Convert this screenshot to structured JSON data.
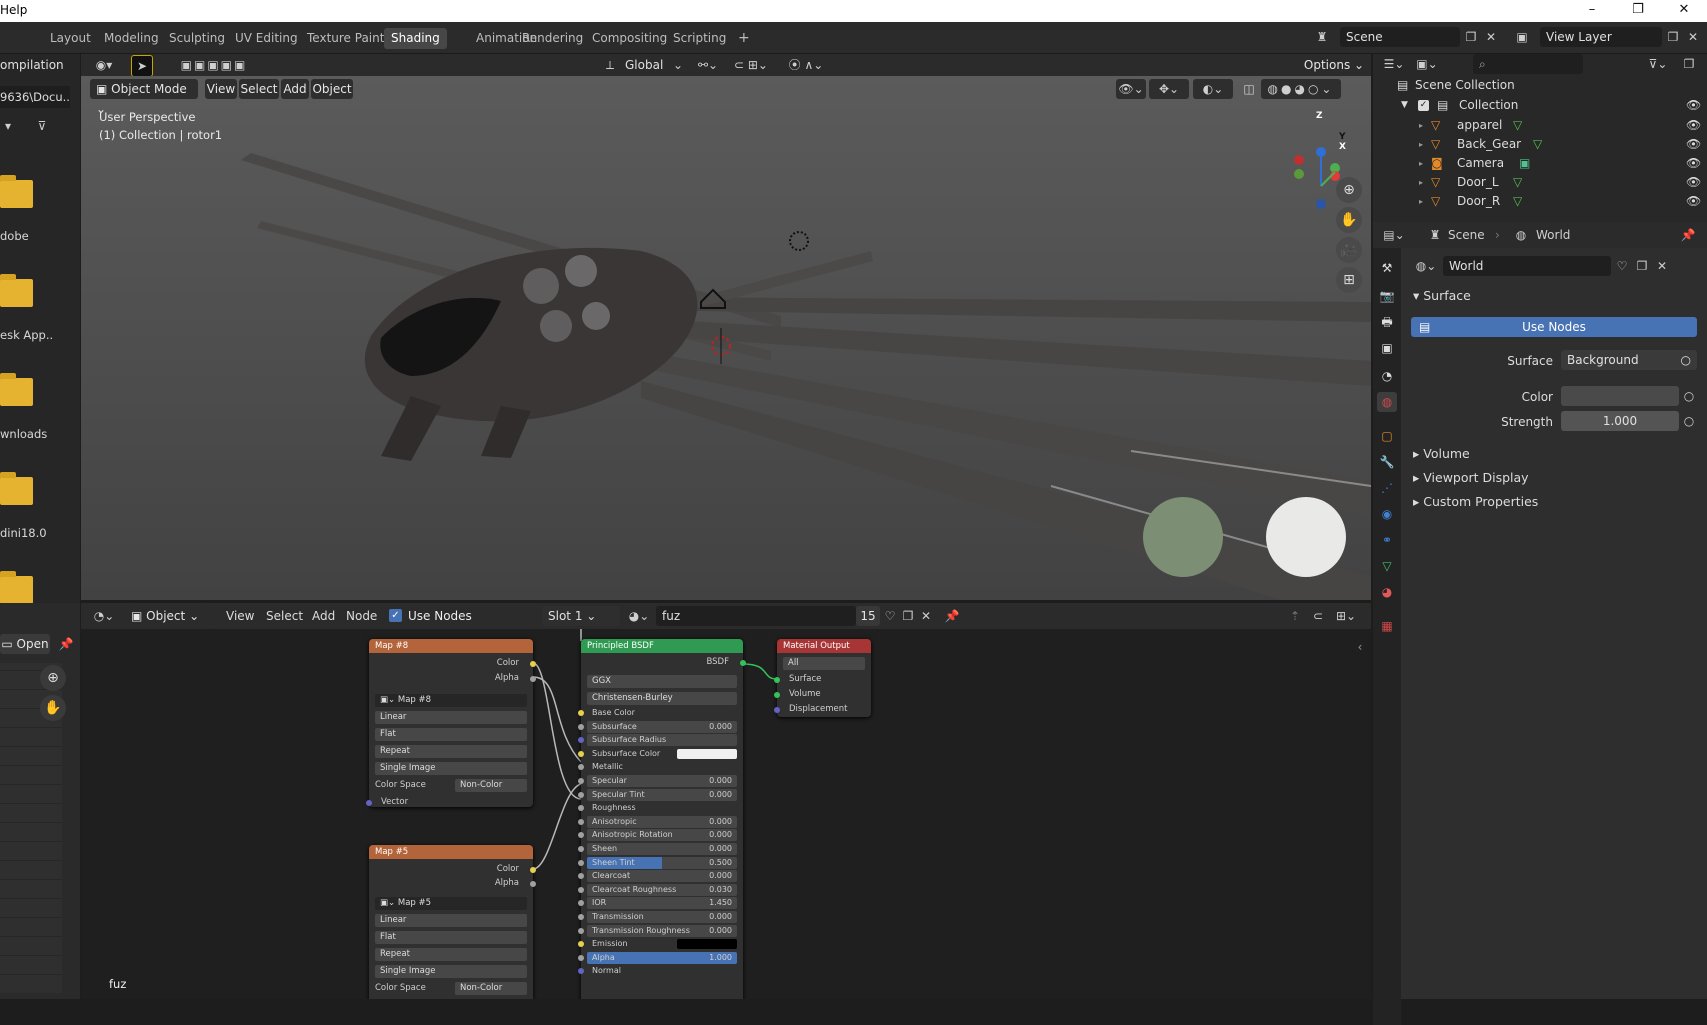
{
  "titlebar": {
    "menu_partial": "Help",
    "min": "–",
    "max": "❐",
    "close": "✕"
  },
  "workspaces": [
    "Layout",
    "Modeling",
    "Sculpting",
    "UV Editing",
    "Texture Paint",
    "Shading",
    "Animation",
    "Rendering",
    "Compositing",
    "Scripting"
  ],
  "active_workspace": "Shading",
  "add_workspace": "+",
  "scene_field": "Scene",
  "viewlayer_field": "View Layer",
  "toolbar": {
    "transform_orientation": "Global",
    "options": "Options"
  },
  "left_panel": {
    "header": "ompilation",
    "path": "9636\\Docu..",
    "items": [
      "dobe",
      "esk App..",
      "wnloads",
      "dini18.0"
    ],
    "open_button": "Open"
  },
  "viewport": {
    "mode": "Object Mode",
    "menus": [
      "View",
      "Select",
      "Add",
      "Object"
    ],
    "perspective": "User Perspective",
    "collection_info": "(1) Collection | rotor1",
    "axes": {
      "z": "Z",
      "y": "Y",
      "x": "X"
    }
  },
  "node_editor": {
    "type": "Object",
    "menus": [
      "View",
      "Select",
      "Add",
      "Node"
    ],
    "use_nodes_label": "Use Nodes",
    "slot": "Slot 1",
    "material": "fuz",
    "users": "15",
    "material_label": "fuz",
    "map8": {
      "title": "Map #8",
      "out_color": "Color",
      "out_alpha": "Alpha",
      "image": "Map #8",
      "interp": "Linear",
      "proj": "Flat",
      "ext": "Repeat",
      "source": "Single Image",
      "colorspace_label": "Color Space",
      "colorspace": "Non-Color",
      "vector": "Vector"
    },
    "map5": {
      "title": "Map #5",
      "out_color": "Color",
      "out_alpha": "Alpha",
      "image": "Map #5",
      "interp": "Linear",
      "proj": "Flat",
      "ext": "Repeat",
      "source": "Single Image",
      "colorspace_label": "Color Space",
      "colorspace": "Non-Color"
    },
    "bsdf": {
      "title": "Principled BSDF",
      "out": "BSDF",
      "distribution": "GGX",
      "subsurface_method": "Christensen-Burley",
      "rows": [
        {
          "label": "Base Color",
          "value": ""
        },
        {
          "label": "Subsurface",
          "value": "0.000"
        },
        {
          "label": "Subsurface Radius",
          "value": ""
        },
        {
          "label": "Subsurface Color",
          "value": ""
        },
        {
          "label": "Metallic",
          "value": ""
        },
        {
          "label": "Specular",
          "value": "0.000"
        },
        {
          "label": "Specular Tint",
          "value": "0.000"
        },
        {
          "label": "Roughness",
          "value": ""
        },
        {
          "label": "Anisotropic",
          "value": "0.000"
        },
        {
          "label": "Anisotropic Rotation",
          "value": "0.000"
        },
        {
          "label": "Sheen",
          "value": "0.000"
        },
        {
          "label": "Sheen Tint",
          "value": "0.500"
        },
        {
          "label": "Clearcoat",
          "value": "0.000"
        },
        {
          "label": "Clearcoat Roughness",
          "value": "0.030"
        },
        {
          "label": "IOR",
          "value": "1.450"
        },
        {
          "label": "Transmission",
          "value": "0.000"
        },
        {
          "label": "Transmission Roughness",
          "value": "0.000"
        },
        {
          "label": "Emission",
          "value": ""
        },
        {
          "label": "Alpha",
          "value": "1.000"
        },
        {
          "label": "Normal",
          "value": ""
        }
      ]
    },
    "output": {
      "title": "Material Output",
      "target": "All",
      "inputs": [
        "Surface",
        "Volume",
        "Displacement"
      ]
    }
  },
  "outliner": {
    "root": "Scene Collection",
    "collection": "Collection",
    "items": [
      "apparel",
      "Back_Gear",
      "Camera",
      "Door_L",
      "Door_R"
    ]
  },
  "properties": {
    "breadcrumb_scene": "Scene",
    "breadcrumb_world": "World",
    "world_name": "World",
    "surface_panel": "Surface",
    "use_nodes": "Use Nodes",
    "surface_label": "Surface",
    "surface_value": "Background",
    "color_label": "Color",
    "strength_label": "Strength",
    "strength_value": "1.000",
    "panels": [
      "Volume",
      "Viewport Display",
      "Custom Properties"
    ]
  },
  "colors": {
    "accent": "#4772b3",
    "texture_header": "#b3643a",
    "shader_header": "#2f9a52",
    "output_header": "#a83535",
    "folder": "#e6b330"
  }
}
